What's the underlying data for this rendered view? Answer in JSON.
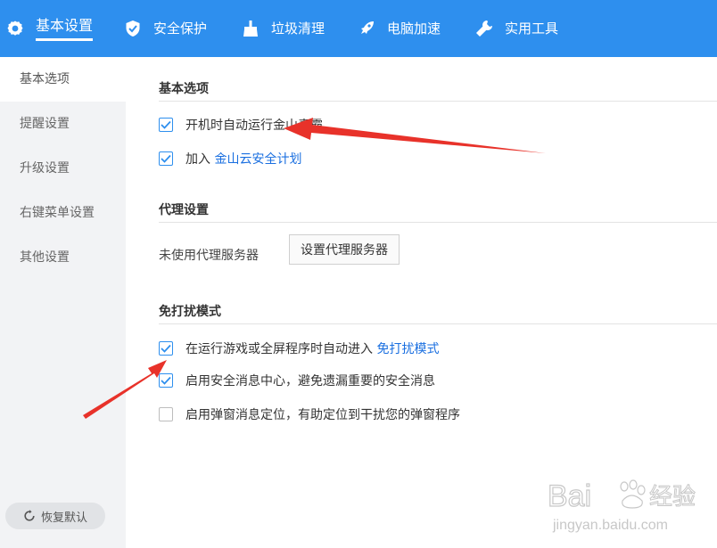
{
  "nav": {
    "tabs": [
      {
        "label": "基本设置",
        "icon": "gear-icon",
        "active": true
      },
      {
        "label": "安全保护",
        "icon": "shield-icon",
        "active": false
      },
      {
        "label": "垃圾清理",
        "icon": "broom-icon",
        "active": false
      },
      {
        "label": "电脑加速",
        "icon": "rocket-icon",
        "active": false
      },
      {
        "label": "实用工具",
        "icon": "wrench-icon",
        "active": false
      }
    ]
  },
  "sidebar": {
    "items": [
      {
        "label": "基本选项",
        "active": true
      },
      {
        "label": "提醒设置",
        "active": false
      },
      {
        "label": "升级设置",
        "active": false
      },
      {
        "label": "右键菜单设置",
        "active": false
      },
      {
        "label": "其他设置",
        "active": false
      }
    ],
    "restore_label": "恢复默认"
  },
  "basic": {
    "title": "基本选项",
    "autostart": {
      "label": "开机时自动运行金山毒霸",
      "checked": true
    },
    "cloud": {
      "prefix": "加入 ",
      "link": "金山云安全计划",
      "checked": true
    }
  },
  "proxy": {
    "title": "代理设置",
    "status": "未使用代理服务器",
    "button_label": "设置代理服务器"
  },
  "dnd": {
    "title": "免打扰模式",
    "auto_game": {
      "prefix": "在运行游戏或全屏程序时自动进入 ",
      "link": "免打扰模式",
      "checked": true
    },
    "msg_center": {
      "label": "启用安全消息中心，避免遗漏重要的安全消息",
      "checked": true
    },
    "popup_locate": {
      "label": "启用弹窗消息定位，有助定位到干扰您的弹窗程序",
      "checked": false
    }
  },
  "watermark": {
    "brand": "Bai",
    "brand2": "经验",
    "url": "jingyan.baidu.com"
  },
  "colors": {
    "accent": "#2e8fee",
    "arrow": "#e8322a",
    "link": "#1a6fe0"
  }
}
